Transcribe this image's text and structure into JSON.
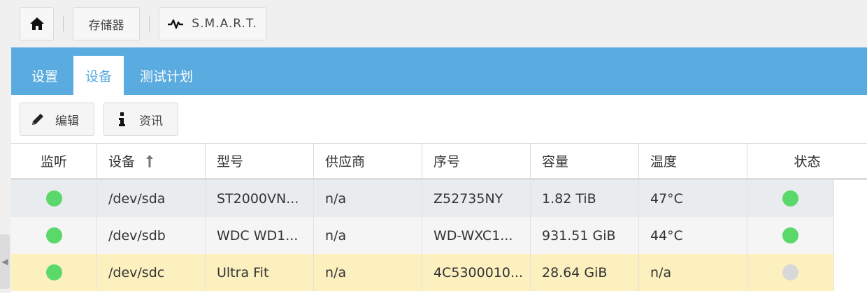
{
  "breadcrumb": {
    "home_icon": "home-icon",
    "storage_label": "存储器",
    "smart_icon": "pulse-icon",
    "smart_label": "S.M.A.R.T."
  },
  "tabs": [
    {
      "label": "设置",
      "active": false
    },
    {
      "label": "设备",
      "active": true
    },
    {
      "label": "测试计划",
      "active": false
    }
  ],
  "toolbar": {
    "edit_label": "编辑",
    "edit_icon": "pencil-icon",
    "info_label": "资讯",
    "info_icon": "info-icon"
  },
  "table": {
    "columns": [
      "监听",
      "设备",
      "型号",
      "供应商",
      "序号",
      "容量",
      "温度",
      "状态"
    ],
    "sort_column": "设备",
    "sort_icon": "arrow-up-icon",
    "rows": [
      {
        "monitor": "green",
        "device": "/dev/sda",
        "model": "ST2000VN...",
        "vendor": "n/a",
        "serial": "Z52735NY",
        "capacity": "1.82 TiB",
        "temp": "47°C",
        "status": "green",
        "bg": "#e9ecef"
      },
      {
        "monitor": "green",
        "device": "/dev/sdb",
        "model": "WDC WD1...",
        "vendor": "n/a",
        "serial": "WD-WXC1...",
        "capacity": "931.51 GiB",
        "temp": "44°C",
        "status": "green",
        "bg": "#f5f5f5"
      },
      {
        "monitor": "green",
        "device": "/dev/sdc",
        "model": "Ultra Fit",
        "vendor": "n/a",
        "serial": "4C5300010...",
        "capacity": "28.64 GiB",
        "temp": "n/a",
        "status": "gray",
        "bg": "#fdf0bf"
      }
    ]
  },
  "colors": {
    "accent": "#5aabdf",
    "green": "#5ad86a",
    "gray": "#d8d8d8"
  }
}
